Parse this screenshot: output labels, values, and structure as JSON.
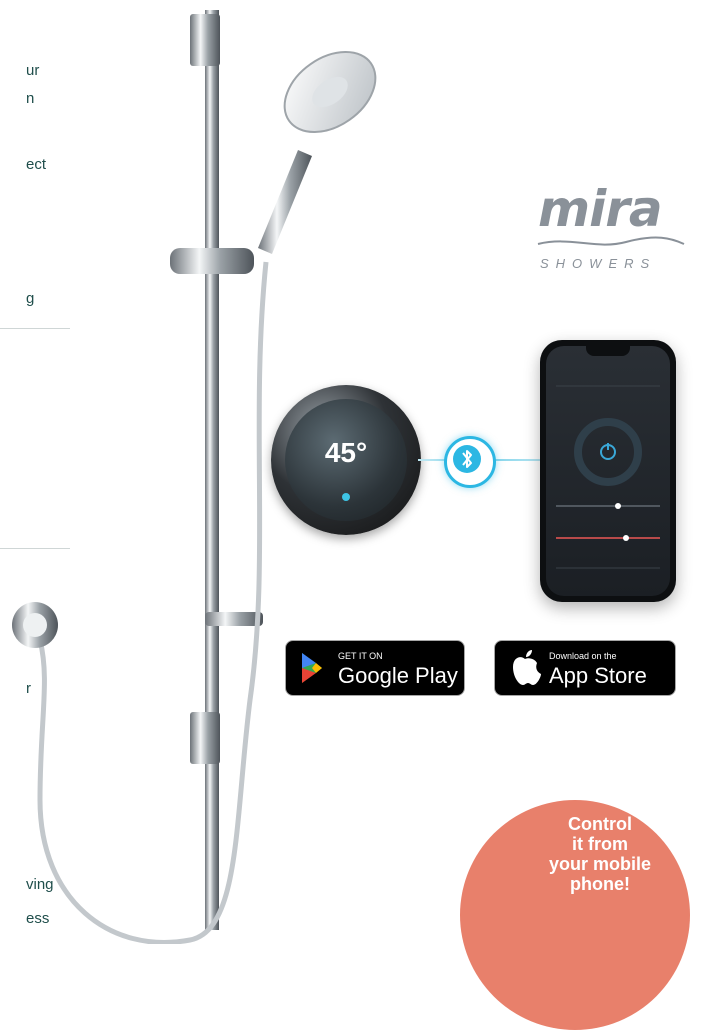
{
  "left_text_fragments": [
    "ur",
    "n",
    "ect",
    "g",
    "r",
    "ving",
    "ess"
  ],
  "logo": {
    "word": "mira",
    "sub": "SHOWERS",
    "color": "#8a9199"
  },
  "controller": {
    "temperature": "45°",
    "accent": "#3ec5e6"
  },
  "bluetooth": {
    "icon": "bluetooth-icon",
    "color": "#2cb7e3"
  },
  "google_play": {
    "small": "GET IT ON",
    "label": "Google Play"
  },
  "app_store": {
    "small": "Download on the",
    "label": "App Store"
  },
  "cta": {
    "lines": [
      "Control",
      "it from",
      "your mobile",
      "phone!"
    ],
    "color": "#e8806b"
  }
}
